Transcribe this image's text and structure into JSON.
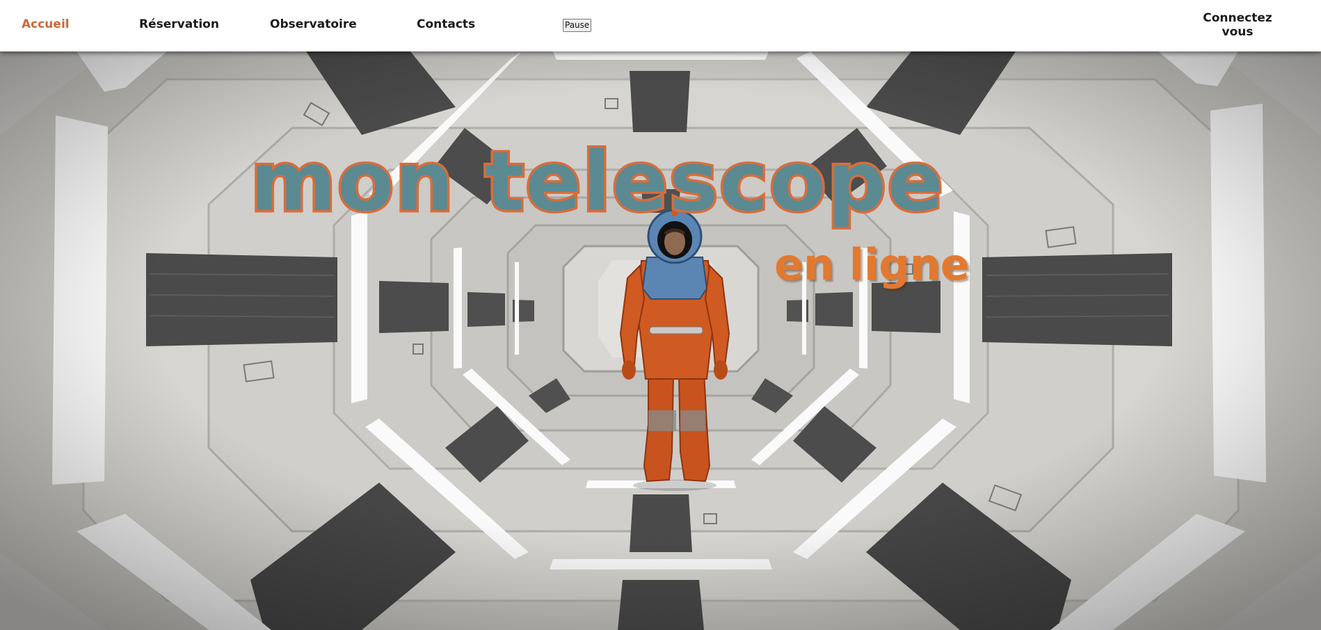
{
  "nav": {
    "home": "Accueil",
    "reservation": "Réservation",
    "observatory": "Observatoire",
    "contacts": "Contacts",
    "pause": "Pause",
    "login_line1": "Connectez",
    "login_line2": "vous"
  },
  "hero": {
    "title": "mon telescope",
    "subtitle": "en ligne",
    "scene": "spaceship-corridor-with-astronaut"
  },
  "colors": {
    "accent": "#c8693a",
    "title_fill": "#5b8a92",
    "title_outline": "#d86d3c",
    "subtitle": "#e2792f",
    "suit_orange": "#cf5a22",
    "suit_blue": "#5b86b3"
  }
}
